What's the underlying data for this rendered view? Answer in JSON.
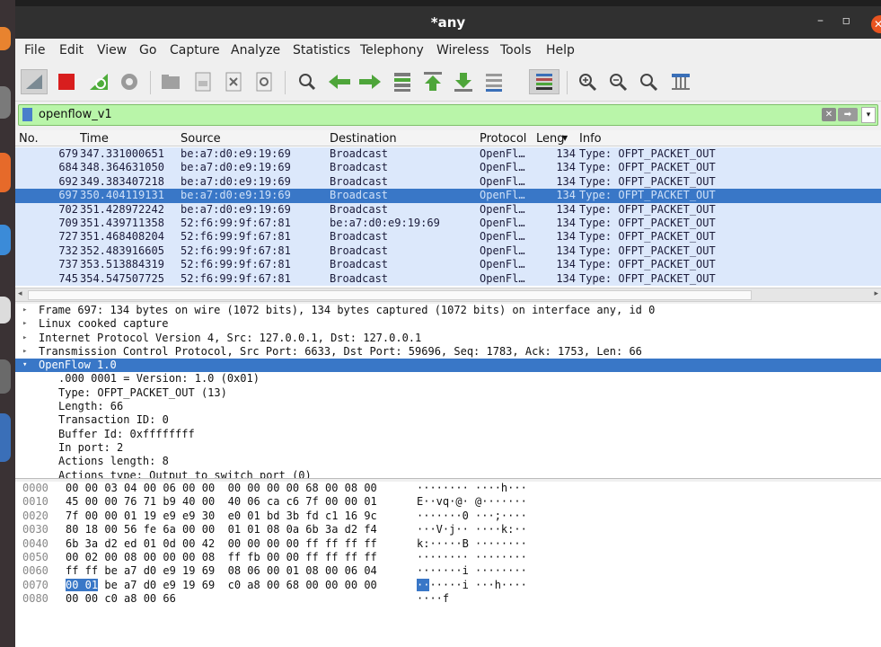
{
  "window": {
    "title": "*any",
    "minimize": "–",
    "maximize": "▫",
    "close": "✕"
  },
  "menu": [
    "File",
    "Edit",
    "View",
    "Go",
    "Capture",
    "Analyze",
    "Statistics",
    "Telephony",
    "Wireless",
    "Tools",
    "Help"
  ],
  "toolbar": {
    "icons": [
      "shark-fin-start-icon",
      "stop-capture-icon",
      "restart-capture-icon",
      "capture-options-icon",
      "open-file-icon",
      "save-file-icon",
      "close-file-icon",
      "reload-file-icon",
      "find-packet-icon",
      "go-back-icon",
      "go-forward-icon",
      "go-to-packet-icon",
      "go-first-icon",
      "go-last-icon",
      "autoscroll-icon",
      "colorize-icon",
      "zoom-in-icon",
      "zoom-out-icon",
      "zoom-normal-icon",
      "resize-columns-icon"
    ]
  },
  "filter": {
    "value": "openflow_v1",
    "clear": "✕",
    "apply": "➡",
    "dropdown": "▾"
  },
  "packet_list": {
    "columns": [
      "No.",
      "Time",
      "Source",
      "Destination",
      "Protocol",
      "Leng",
      "Info"
    ],
    "rows": [
      {
        "no": "679",
        "time": "347.331000651",
        "src": "be:a7:d0:e9:19:69",
        "dst": "Broadcast",
        "proto": "OpenFl…",
        "len": "134",
        "info": "Type: OFPT_PACKET_OUT"
      },
      {
        "no": "684",
        "time": "348.364631050",
        "src": "be:a7:d0:e9:19:69",
        "dst": "Broadcast",
        "proto": "OpenFl…",
        "len": "134",
        "info": "Type: OFPT_PACKET_OUT"
      },
      {
        "no": "692",
        "time": "349.383407218",
        "src": "be:a7:d0:e9:19:69",
        "dst": "Broadcast",
        "proto": "OpenFl…",
        "len": "134",
        "info": "Type: OFPT_PACKET_OUT"
      },
      {
        "no": "697",
        "time": "350.404119131",
        "src": "be:a7:d0:e9:19:69",
        "dst": "Broadcast",
        "proto": "OpenFl…",
        "len": "134",
        "info": "Type: OFPT_PACKET_OUT",
        "selected": true
      },
      {
        "no": "702",
        "time": "351.428972242",
        "src": "be:a7:d0:e9:19:69",
        "dst": "Broadcast",
        "proto": "OpenFl…",
        "len": "134",
        "info": "Type: OFPT_PACKET_OUT"
      },
      {
        "no": "709",
        "time": "351.439711358",
        "src": "52:f6:99:9f:67:81",
        "dst": "be:a7:d0:e9:19:69",
        "proto": "OpenFl…",
        "len": "134",
        "info": "Type: OFPT_PACKET_OUT"
      },
      {
        "no": "727",
        "time": "351.468408204",
        "src": "52:f6:99:9f:67:81",
        "dst": "Broadcast",
        "proto": "OpenFl…",
        "len": "134",
        "info": "Type: OFPT_PACKET_OUT"
      },
      {
        "no": "732",
        "time": "352.483916605",
        "src": "52:f6:99:9f:67:81",
        "dst": "Broadcast",
        "proto": "OpenFl…",
        "len": "134",
        "info": "Type: OFPT_PACKET_OUT"
      },
      {
        "no": "737",
        "time": "353.513884319",
        "src": "52:f6:99:9f:67:81",
        "dst": "Broadcast",
        "proto": "OpenFl…",
        "len": "134",
        "info": "Type: OFPT_PACKET_OUT"
      },
      {
        "no": "745",
        "time": "354.547507725",
        "src": "52:f6:99:9f:67:81",
        "dst": "Broadcast",
        "proto": "OpenFl…",
        "len": "134",
        "info": "Type: OFPT_PACKET_OUT"
      }
    ]
  },
  "details": [
    {
      "text": "Frame 697: 134 bytes on wire (1072 bits), 134 bytes captured (1072 bits) on interface any, id 0",
      "expander": "▸",
      "level": 0
    },
    {
      "text": "Linux cooked capture",
      "expander": "▸",
      "level": 0
    },
    {
      "text": "Internet Protocol Version 4, Src: 127.0.0.1, Dst: 127.0.0.1",
      "expander": "▸",
      "level": 0
    },
    {
      "text": "Transmission Control Protocol, Src Port: 6633, Dst Port: 59696, Seq: 1783, Ack: 1753, Len: 66",
      "expander": "▸",
      "level": 0
    },
    {
      "text": "OpenFlow 1.0",
      "expander": "▾",
      "level": 0,
      "selected": true
    },
    {
      "text": ".000 0001 = Version: 1.0 (0x01)",
      "expander": "",
      "level": 1
    },
    {
      "text": "Type: OFPT_PACKET_OUT (13)",
      "expander": "",
      "level": 1
    },
    {
      "text": "Length: 66",
      "expander": "",
      "level": 1
    },
    {
      "text": "Transaction ID: 0",
      "expander": "",
      "level": 1
    },
    {
      "text": "Buffer Id: 0xffffffff",
      "expander": "",
      "level": 1
    },
    {
      "text": "In port: 2",
      "expander": "",
      "level": 1
    },
    {
      "text": "Actions length: 8",
      "expander": "",
      "level": 1
    },
    {
      "text": "Actions type: Output to switch port (0)",
      "expander": "",
      "level": 1
    }
  ],
  "bytes": [
    {
      "off": "0000",
      "hex": "00 00 03 04 00 06 00 00  00 00 00 00 68 00 08 00",
      "ascii": "········ ····h···"
    },
    {
      "off": "0010",
      "hex": "45 00 00 76 71 b9 40 00  40 06 ca c6 7f 00 00 01",
      "ascii": "E··vq·@· @·······"
    },
    {
      "off": "0020",
      "hex": "7f 00 00 01 19 e9 e9 30  e0 01 bd 3b fd c1 16 9c",
      "ascii": "·······0 ···;····"
    },
    {
      "off": "0030",
      "hex": "80 18 00 56 fe 6a 00 00  01 01 08 0a 6b 3a d2 f4",
      "ascii": "···V·j·· ····k:··"
    },
    {
      "off": "0040",
      "hex": "6b 3a d2 ed 01 0d 00 42  00 00 00 00 ff ff ff ff",
      "ascii": "k:·····B ········"
    },
    {
      "off": "0050",
      "hex": "00 02 00 08 00 00 00 08  ff fb 00 00 ff ff ff ff",
      "ascii": "········ ········"
    },
    {
      "off": "0060",
      "hex": "ff ff be a7 d0 e9 19 69  08 06 00 01 08 00 06 04",
      "ascii": "·······i ········"
    },
    {
      "off": "0070",
      "hex_hl": "00 01",
      "hex": " be a7 d0 e9 19 69  c0 a8 00 68 00 00 00 00",
      "ascii_hl": "··",
      "ascii": "·····i ···h····"
    },
    {
      "off": "0080",
      "hex": "00 00 c0 a8 00 66",
      "ascii": "····f"
    }
  ],
  "colors": {
    "row_bg": "#dce8fb",
    "selected": "#3977c7",
    "filter_ok": "#b9f5a9"
  }
}
